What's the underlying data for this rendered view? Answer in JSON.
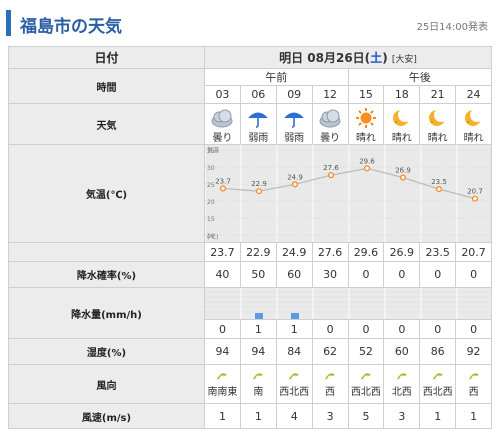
{
  "header": {
    "title": "福島市の天気",
    "issued": "25日14:00発表"
  },
  "labels": {
    "date": "日付",
    "time": "時間",
    "weather": "天気",
    "temperature": "気温(℃)",
    "precip_prob": "降水確率(%)",
    "precip_amount": "降水量(mm/h)",
    "humidity": "湿度(%)",
    "wind_dir": "風向",
    "wind_speed": "風速(m/s)"
  },
  "date": {
    "prefix": "明日 08月26日(",
    "weekday": "土",
    "suffix": ")",
    "rokuyo": "[大安]"
  },
  "periods": {
    "am": "午前",
    "pm": "午後"
  },
  "hours": [
    "03",
    "06",
    "09",
    "12",
    "15",
    "18",
    "21",
    "24"
  ],
  "weather": [
    {
      "label": "曇り",
      "icon": "cloud-icon"
    },
    {
      "label": "弱雨",
      "icon": "umbrella-icon"
    },
    {
      "label": "弱雨",
      "icon": "umbrella-icon"
    },
    {
      "label": "曇り",
      "icon": "cloud-icon"
    },
    {
      "label": "晴れ",
      "icon": "sun-icon"
    },
    {
      "label": "晴れ",
      "icon": "moon-icon"
    },
    {
      "label": "晴れ",
      "icon": "moon-icon"
    },
    {
      "label": "晴れ",
      "icon": "moon-icon"
    }
  ],
  "chart_data": {
    "type": "line",
    "axis_title": "気温",
    "axis_unit": "(℃)",
    "y_ticks": [
      35,
      30,
      25,
      20,
      15,
      10
    ],
    "ylim": [
      10,
      35
    ],
    "x": [
      "03",
      "06",
      "09",
      "12",
      "15",
      "18",
      "21",
      "24"
    ],
    "values": [
      23.7,
      22.9,
      24.9,
      27.6,
      29.6,
      26.9,
      23.5,
      20.7
    ],
    "point_labels": [
      "23.7",
      "22.9",
      "24.9",
      "27.6",
      "29.6",
      "26.9",
      "23.5",
      "20.7"
    ],
    "grid": true
  },
  "temps": [
    "23.7",
    "22.9",
    "24.9",
    "27.6",
    "29.6",
    "26.9",
    "23.5",
    "20.7"
  ],
  "precip_prob": [
    "40",
    "50",
    "60",
    "30",
    "0",
    "0",
    "0",
    "0"
  ],
  "precip_amount": [
    0,
    1,
    1,
    0,
    0,
    0,
    0,
    0
  ],
  "precip_amount_text": [
    "0",
    "1",
    "1",
    "0",
    "0",
    "0",
    "0",
    "0"
  ],
  "humidity": [
    "94",
    "94",
    "84",
    "62",
    "52",
    "60",
    "86",
    "92"
  ],
  "wind_dir": [
    "南南東",
    "南",
    "西北西",
    "西",
    "西北西",
    "北西",
    "西北西",
    "西"
  ],
  "wind_speed": [
    "1",
    "1",
    "4",
    "3",
    "5",
    "3",
    "1",
    "1"
  ],
  "colors": {
    "accent": "#2a6ebb",
    "line": "#b9b9b9",
    "point": "#f08c1e",
    "rain": "#5b9be0",
    "saturday": "#1a55c8"
  }
}
